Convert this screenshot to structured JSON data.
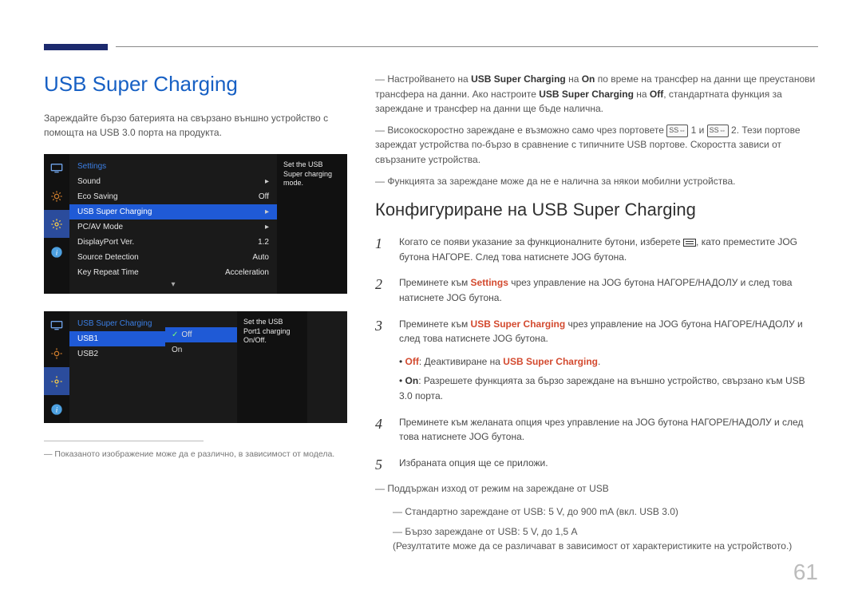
{
  "page_number": "61",
  "title": "USB Super Charging",
  "intro": "Зареждайте бързо батерията на свързано външно устройство с помощта на USB 3.0 порта на продукта.",
  "osd1": {
    "header": "Settings",
    "items": [
      {
        "label": "Sound",
        "value": "",
        "caret": "▸"
      },
      {
        "label": "Eco Saving",
        "value": "Off",
        "caret": ""
      },
      {
        "label": "USB Super Charging",
        "value": "",
        "caret": "▸"
      },
      {
        "label": "PC/AV Mode",
        "value": "",
        "caret": "▸"
      },
      {
        "label": "DisplayPort Ver.",
        "value": "1.2",
        "caret": ""
      },
      {
        "label": "Source Detection",
        "value": "Auto",
        "caret": ""
      },
      {
        "label": "Key Repeat Time",
        "value": "Acceleration",
        "caret": ""
      }
    ],
    "side": "Set the USB Super charging mode."
  },
  "osd2": {
    "header": "USB Super Charging",
    "items": [
      {
        "label": "USB1"
      },
      {
        "label": "USB2"
      }
    ],
    "options": [
      {
        "label": "Off",
        "checked": true
      },
      {
        "label": "On",
        "checked": false
      }
    ],
    "side": "Set the USB Port1 charging On/Off."
  },
  "footnote": "Показаното изображение може да е различно, в зависимост от модела.",
  "right_notes": {
    "n1_a": "Настройването на ",
    "n1_b": "USB Super Charging",
    "n1_c": " на ",
    "n1_d": "On",
    "n1_e": " по време на трансфер на данни ще преустанови трансфера на данни. Ако настроите ",
    "n1_f": "USB Super Charging",
    "n1_g": " на ",
    "n1_h": "Off",
    "n1_i": ", стандартната функция за зареждане и трансфер на данни ще бъде налична.",
    "n2_a": "Високоскоростно зареждане е възможно само чрез портовете ",
    "n2_b": "1",
    "n2_c": " и ",
    "n2_d": "2",
    "n2_e": ". Тези портове зареждат устройства по-бързо в сравнение с типичните USB портове. Скоростта зависи от свързаните устройства.",
    "n3": "Функцията за зареждане може да не е налична за някои мобилни устройства."
  },
  "config_title": "Конфигуриране на USB Super Charging",
  "steps": {
    "s1_a": "Когато се появи указание за функционалните бутони, изберете ",
    "s1_b": ", като преместите JOG бутона НАГОРЕ. След това натиснете JOG бутона.",
    "s2_a": "Преминете към ",
    "s2_b": "Settings",
    "s2_c": " чрез управление на JOG бутона НАГОРЕ/НАДОЛУ и след това натиснете JOG бутона.",
    "s3_a": "Преминете към ",
    "s3_b": "USB Super Charging",
    "s3_c": " чрез управление на JOG бутона НАГОРЕ/НАДОЛУ и след това натиснете JOG бутона.",
    "s3_off_a": "Off",
    "s3_off_b": ": Деактивиране на ",
    "s3_off_c": "USB Super Charging",
    "s3_off_d": ".",
    "s3_on_a": "On",
    "s3_on_b": ": Разрешете функцията за бързо зареждане на външно устройство, свързано към USB 3.0 порта.",
    "s4": "Преминете към желаната опция чрез управление на JOG бутона НАГОРЕ/НАДОЛУ и след това натиснете JOG бутона.",
    "s5": "Избраната опция ще се приложи."
  },
  "output_notes": {
    "o1": "Поддържан изход от режим на зареждане от USB",
    "o2": "Стандартно зареждане от USB: 5 V, до 900 mA (вкл. USB 3.0)",
    "o3_a": "Бързо зареждане от USB: 5 V, до 1,5 A",
    "o3_b": "(Резултатите може да се различават в зависимост от характеристиките на устройството.)"
  }
}
